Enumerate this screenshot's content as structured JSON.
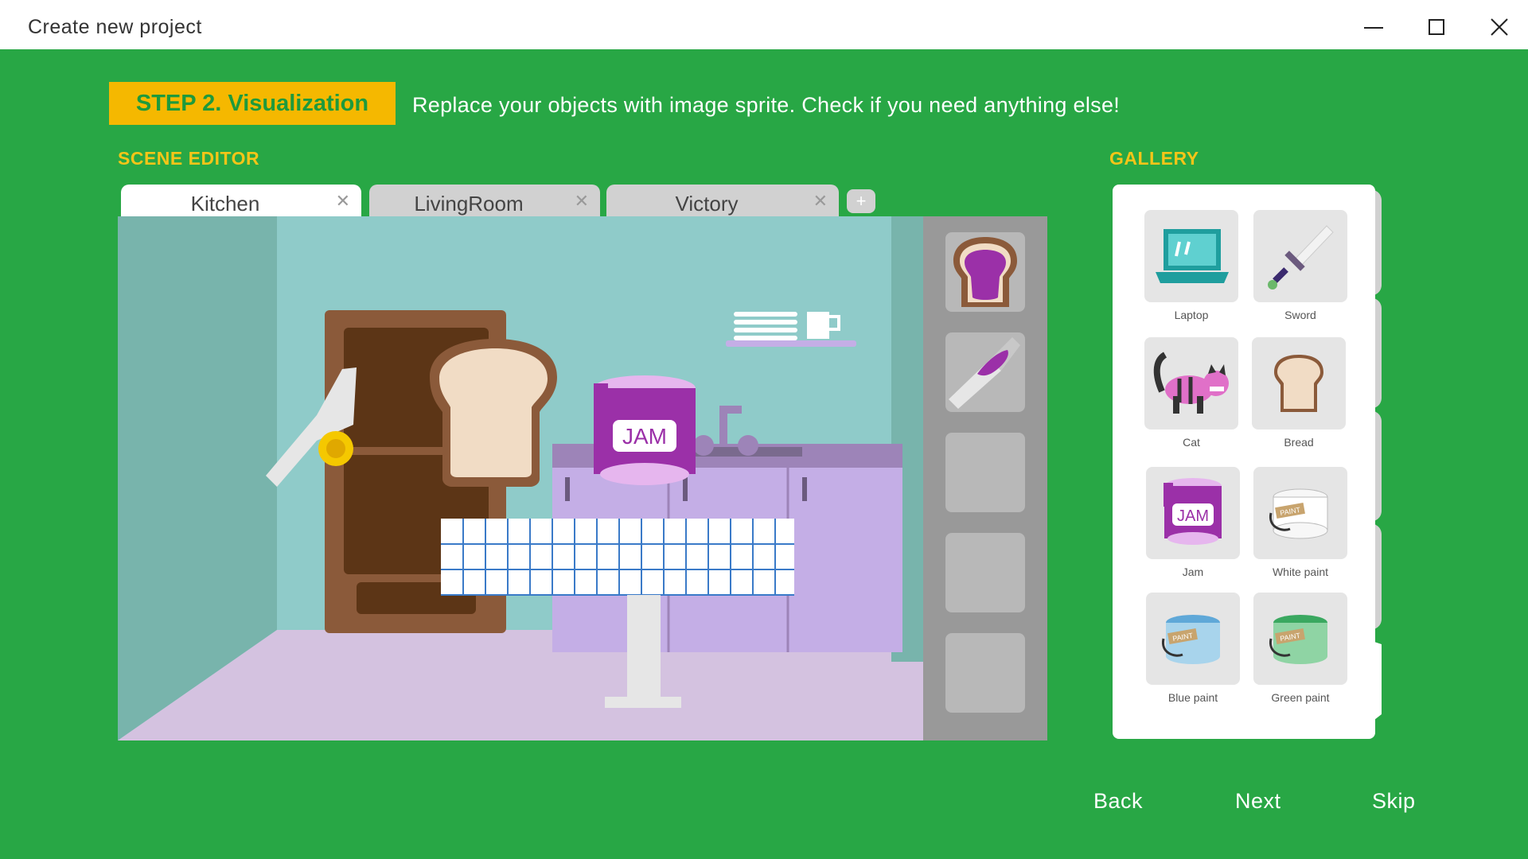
{
  "window": {
    "title": "Create new project",
    "controls": [
      "minimize-icon",
      "maximize-icon",
      "close-icon"
    ]
  },
  "step": {
    "badge": "STEP 2. Visualization",
    "description": "Replace your objects with image sprite. Check if you need anything else!"
  },
  "scene_editor": {
    "label": "SCENE EDITOR",
    "tabs": [
      {
        "label": "Kitchen",
        "active": true
      },
      {
        "label": "LivingRoom",
        "active": false
      },
      {
        "label": "Victory",
        "active": false
      }
    ],
    "add_tab": "+",
    "scene_objects": [
      "door",
      "knife",
      "coin",
      "bread",
      "jam",
      "sink",
      "shelf",
      "cup",
      "table",
      "counter"
    ],
    "jam_label": "JAM",
    "sprite_slots": [
      "jam-toast",
      "knife-with-jam",
      "empty",
      "empty",
      "empty"
    ]
  },
  "gallery": {
    "label": "GALLERY",
    "items": [
      {
        "label": "Laptop",
        "icon": "laptop-icon"
      },
      {
        "label": "Sword",
        "icon": "sword-icon"
      },
      {
        "label": "Cat",
        "icon": "cat-icon"
      },
      {
        "label": "Bread",
        "icon": "bread-icon"
      },
      {
        "label": "Jam",
        "icon": "jam-icon"
      },
      {
        "label": "White paint",
        "icon": "white-paint-icon"
      },
      {
        "label": "Blue paint",
        "icon": "blue-paint-icon"
      },
      {
        "label": "Green paint",
        "icon": "green-paint-icon"
      }
    ],
    "paint_label": "PAINT"
  },
  "nav": {
    "back": "Back",
    "next": "Next",
    "skip": "Skip"
  },
  "colors": {
    "background": "#28a745",
    "accent": "#f5b800",
    "jam": "#9b30a8",
    "counter": "#c4aee6"
  }
}
